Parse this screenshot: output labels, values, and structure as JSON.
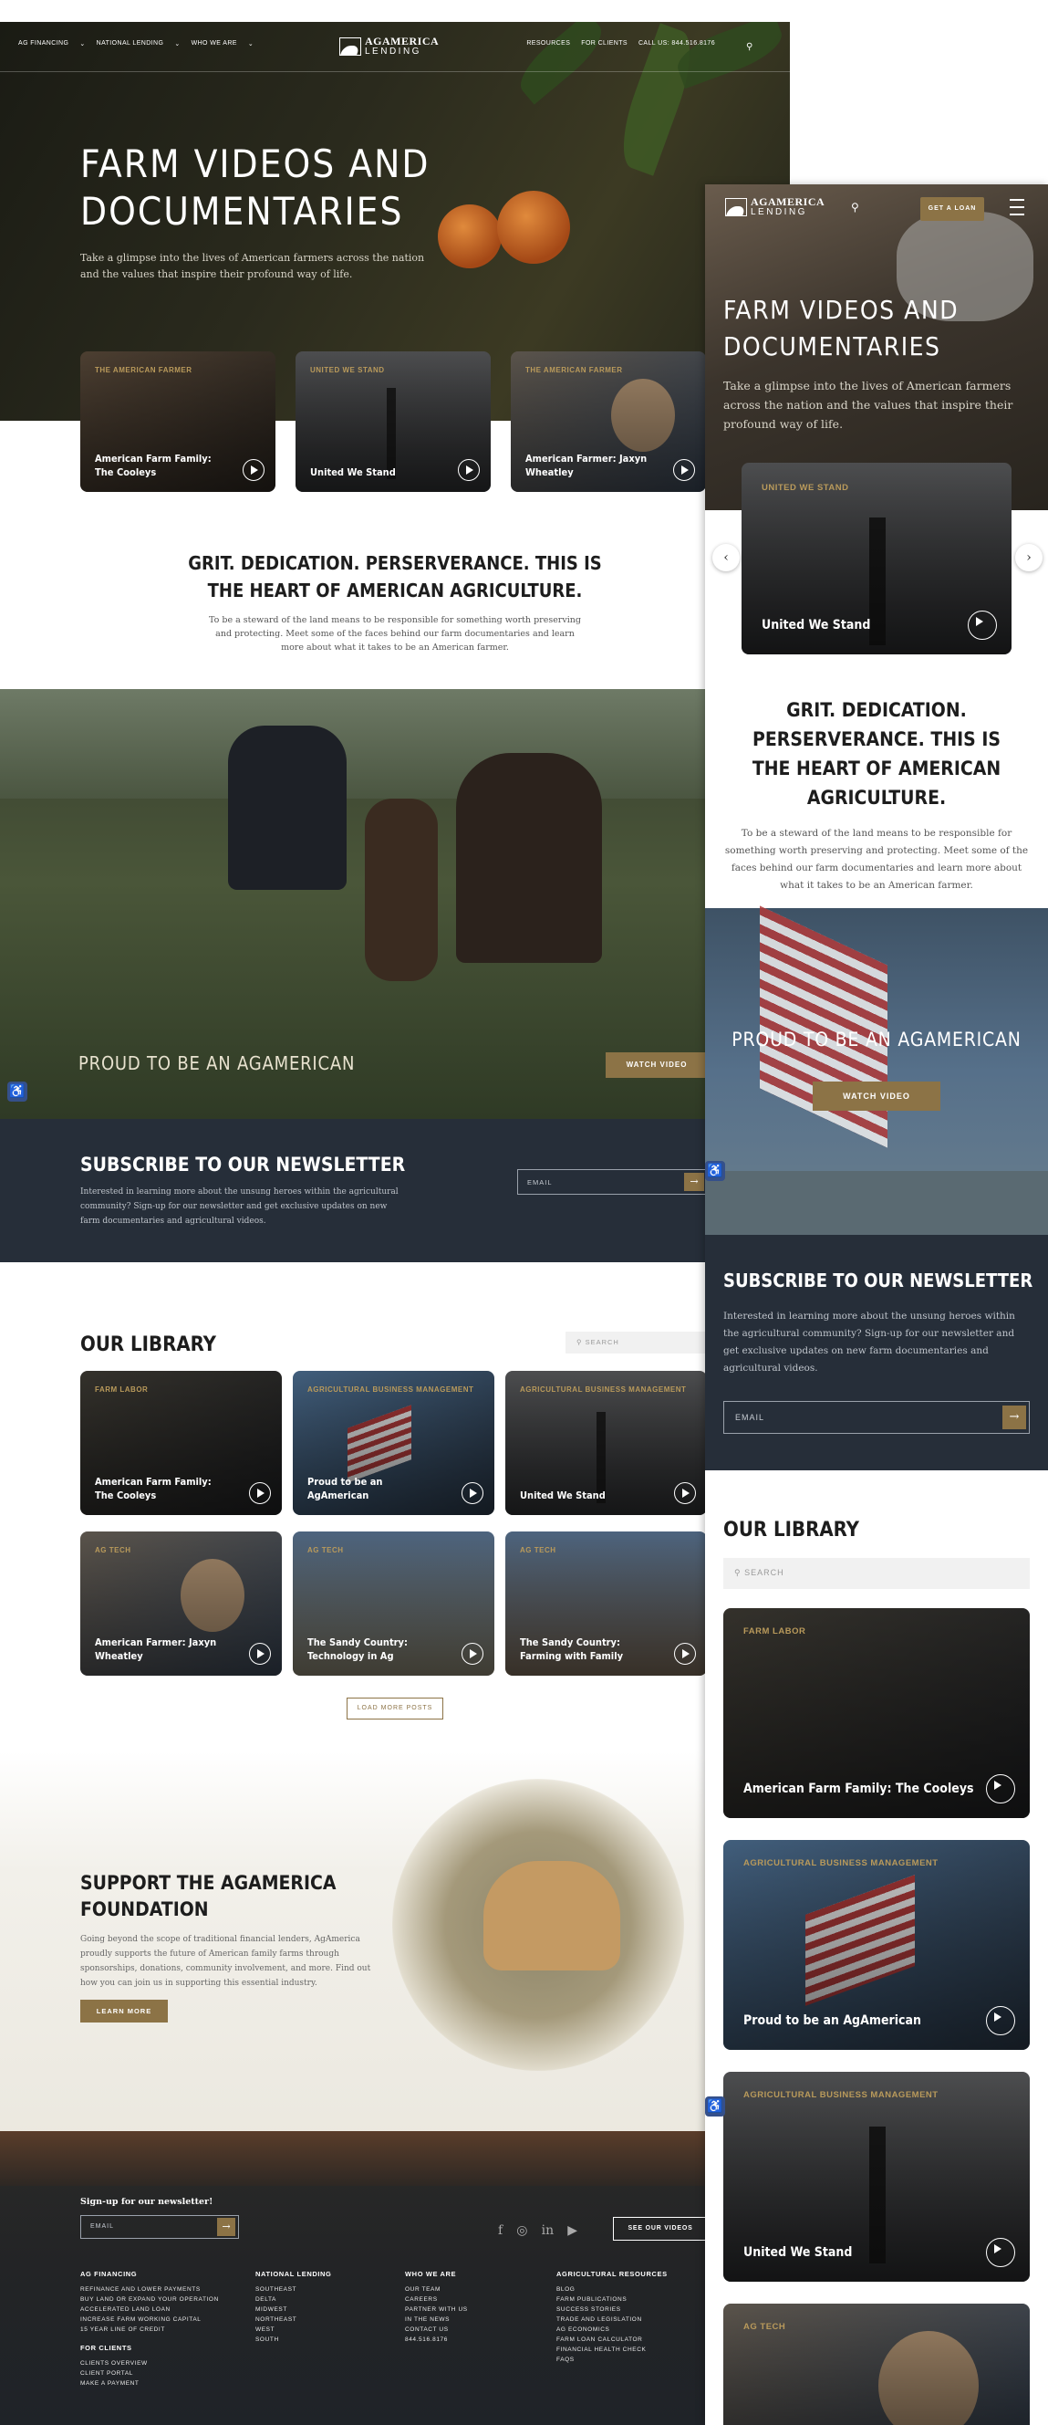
{
  "desktop": {
    "nav": {
      "left": [
        "AG FINANCING",
        "NATIONAL LENDING",
        "WHO WE ARE"
      ],
      "right": [
        "RESOURCES",
        "FOR CLIENTS"
      ],
      "call": "CALL US: 844.516.8176",
      "logo_top": "AGAMERICA",
      "logo_bottom": "LENDING"
    },
    "hero": {
      "title_line1": "FARM VIDEOS AND",
      "title_line2": "DOCUMENTARIES",
      "subtitle": "Take a glimpse into the lives of American farmers across the nation and the values that inspire their profound way of life."
    },
    "featured": [
      {
        "tag": "THE AMERICAN FARMER",
        "title": "American Farm Family: The Cooleys"
      },
      {
        "tag": "UNITED WE STAND",
        "title": "United We Stand"
      },
      {
        "tag": "THE AMERICAN FARMER",
        "title": "American Farmer: Jaxyn Wheatley"
      }
    ],
    "intro": {
      "heading_line1": "GRIT. DEDICATION. PERSERVERANCE. THIS IS",
      "heading_line2": "THE HEART OF AMERICAN AGRICULTURE.",
      "body": "To be a steward of the land means to be responsible for something worth preserving and protecting. Meet some of the faces behind our farm documentaries and learn more about what it takes to be an American farmer."
    },
    "video_banner": {
      "title": "PROUD TO BE AN AGAMERICAN",
      "button": "WATCH VIDEO"
    },
    "newsletter": {
      "title": "SUBSCRIBE TO OUR NEWSLETTER",
      "body": "Interested in learning more about the unsung heroes within the agricultural community? Sign-up for our newsletter and get exclusive updates on new farm documentaries and agricultural videos.",
      "email_placeholder": "EMAIL",
      "submit": "→"
    },
    "library": {
      "title": "OUR LIBRARY",
      "search_placeholder": "SEARCH",
      "items": [
        {
          "tag": "FARM LABOR",
          "title": "American Farm Family: The Cooleys"
        },
        {
          "tag": "AGRICULTURAL BUSINESS MANAGEMENT",
          "title": "Proud to be an AgAmerican"
        },
        {
          "tag": "AGRICULTURAL BUSINESS MANAGEMENT",
          "title": "United We Stand"
        },
        {
          "tag": "AG TECH",
          "title": "American Farmer: Jaxyn Wheatley"
        },
        {
          "tag": "AG TECH",
          "title": "The Sandy Country: Technology in Ag"
        },
        {
          "tag": "AG TECH",
          "title": "The Sandy Country: Farming with Family"
        }
      ],
      "load_more": "LOAD MORE POSTS"
    },
    "foundation": {
      "title_line1": "SUPPORT THE AGAMERICA",
      "title_line2": "FOUNDATION",
      "body": "Going beyond the scope of traditional financial lenders, AgAmerica proudly supports the future of American family farms through sponsorships, donations, community involvement, and more. Find out how you can join us in supporting this essential industry.",
      "button": "LEARN MORE"
    },
    "footer": {
      "signup": "Sign-up for our newsletter!",
      "email_placeholder": "EMAIL",
      "see_videos": "SEE OUR VIDEOS",
      "social": [
        "f",
        "◎",
        "in",
        "▶"
      ],
      "columns": [
        {
          "heading": "AG FINANCING",
          "items": [
            "REFINANCE AND LOWER PAYMENTS",
            "BUY LAND OR EXPAND YOUR OPERATION",
            "ACCELERATED LAND LOAN",
            "INCREASE FARM WORKING CAPITAL",
            "15 YEAR LINE OF CREDIT"
          ]
        },
        {
          "heading": "NATIONAL LENDING",
          "items": [
            "SOUTHEAST",
            "DELTA",
            "MIDWEST",
            "NORTHEAST",
            "WEST",
            "SOUTH"
          ]
        },
        {
          "heading": "WHO WE ARE",
          "items": [
            "OUR TEAM",
            "CAREERS",
            "PARTNER WITH US",
            "IN THE NEWS",
            "CONTACT US",
            "844.516.8176"
          ]
        },
        {
          "heading": "AGRICULTURAL RESOURCES",
          "items": [
            "BLOG",
            "FARM PUBLICATIONS",
            "SUCCESS STORIES",
            "TRADE AND LEGISLATION",
            "AG ECONOMICS",
            "FARM LOAN CALCULATOR",
            "FINANCIAL HEALTH CHECK",
            "FAQS"
          ]
        }
      ],
      "clients": {
        "heading": "FOR CLIENTS",
        "items": [
          "CLIENTS OVERVIEW",
          "CLIENT PORTAL",
          "MAKE A PAYMENT"
        ]
      }
    }
  },
  "mobile": {
    "get_loan": "GET A LOAN",
    "logo_top": "AGAMERICA",
    "logo_bottom": "LENDING",
    "hero_title_line1": "FARM VIDEOS AND",
    "hero_title_line2": "DOCUMENTARIES",
    "hero_subtitle": "Take a glimpse into the lives of American farmers across the nation and the values that inspire their profound way of life.",
    "carousel": {
      "tag": "UNITED WE STAND",
      "title": "United We Stand"
    },
    "intro_heading": "GRIT. DEDICATION. PERSERVERANCE. THIS IS THE HEART OF AMERICAN AGRICULTURE.",
    "intro_body": "To be a steward of the land means to be responsible for something worth preserving and protecting. Meet some of the faces behind our farm documentaries and learn more about what it takes to be an American farmer.",
    "banner_title": "PROUD TO BE AN AGAMERICAN",
    "banner_button": "WATCH VIDEO",
    "newsletter_title": "SUBSCRIBE TO OUR NEWSLETTER",
    "newsletter_body": "Interested in learning more about the unsung heroes within the agricultural community? Sign-up for our newsletter and get exclusive updates on new farm documentaries and agricultural videos.",
    "email_placeholder": "EMAIL",
    "library_title": "OUR LIBRARY",
    "search_placeholder": "SEARCH",
    "library": [
      {
        "tag": "FARM LABOR",
        "title": "American Farm Family: The Cooleys"
      },
      {
        "tag": "AGRICULTURAL BUSINESS MANAGEMENT",
        "title": "Proud to be an AgAmerican"
      },
      {
        "tag": "AGRICULTURAL BUSINESS MANAGEMENT",
        "title": "United We Stand"
      },
      {
        "tag": "AG TECH",
        "title": ""
      }
    ]
  },
  "colors": {
    "accent": "#8c7346",
    "tag": "#b99a5b",
    "navy": "#262e39"
  }
}
